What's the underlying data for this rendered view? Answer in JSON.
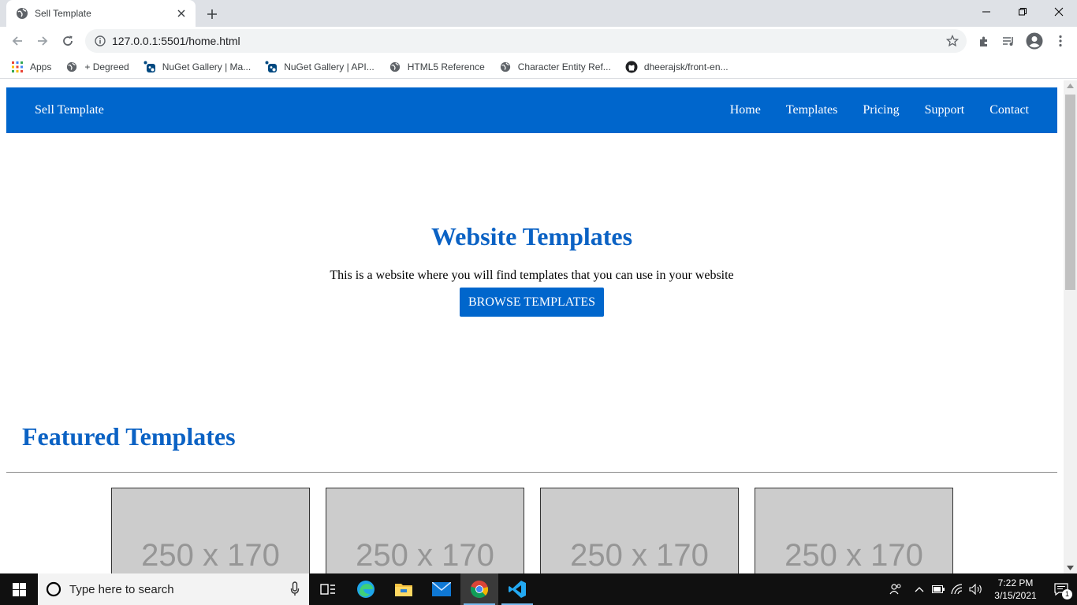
{
  "browser": {
    "tab_title": "Sell Template",
    "url": "127.0.0.1:5501/home.html",
    "bookmarks": [
      {
        "label": "Apps",
        "icon": "apps-grid-icon"
      },
      {
        "label": "+ Degreed",
        "icon": "globe-icon"
      },
      {
        "label": "NuGet Gallery | Ma...",
        "icon": "nuget-icon"
      },
      {
        "label": "NuGet Gallery | API...",
        "icon": "nuget-icon"
      },
      {
        "label": "HTML5 Reference",
        "icon": "globe-icon"
      },
      {
        "label": "Character Entity Ref...",
        "icon": "globe-icon"
      },
      {
        "label": "dheerajsk/front-en...",
        "icon": "github-icon"
      }
    ]
  },
  "site": {
    "brand": "Sell Template",
    "nav": [
      "Home",
      "Templates",
      "Pricing",
      "Support",
      "Contact"
    ],
    "hero": {
      "title": "Website Templates",
      "subtitle": "This is a website where you will find templates that you can use in your website",
      "cta": "BROWSE TEMPLATES"
    },
    "featured": {
      "title": "Featured Templates",
      "cards": [
        "250 x 170",
        "250 x 170",
        "250 x 170",
        "250 x 170"
      ]
    },
    "colors": {
      "primary": "#0066cc",
      "heading": "#0b62c4",
      "placeholder": "#cccccc"
    }
  },
  "taskbar": {
    "search_placeholder": "Type here to search",
    "time": "7:22 PM",
    "date": "3/15/2021",
    "notification_count": "1"
  }
}
